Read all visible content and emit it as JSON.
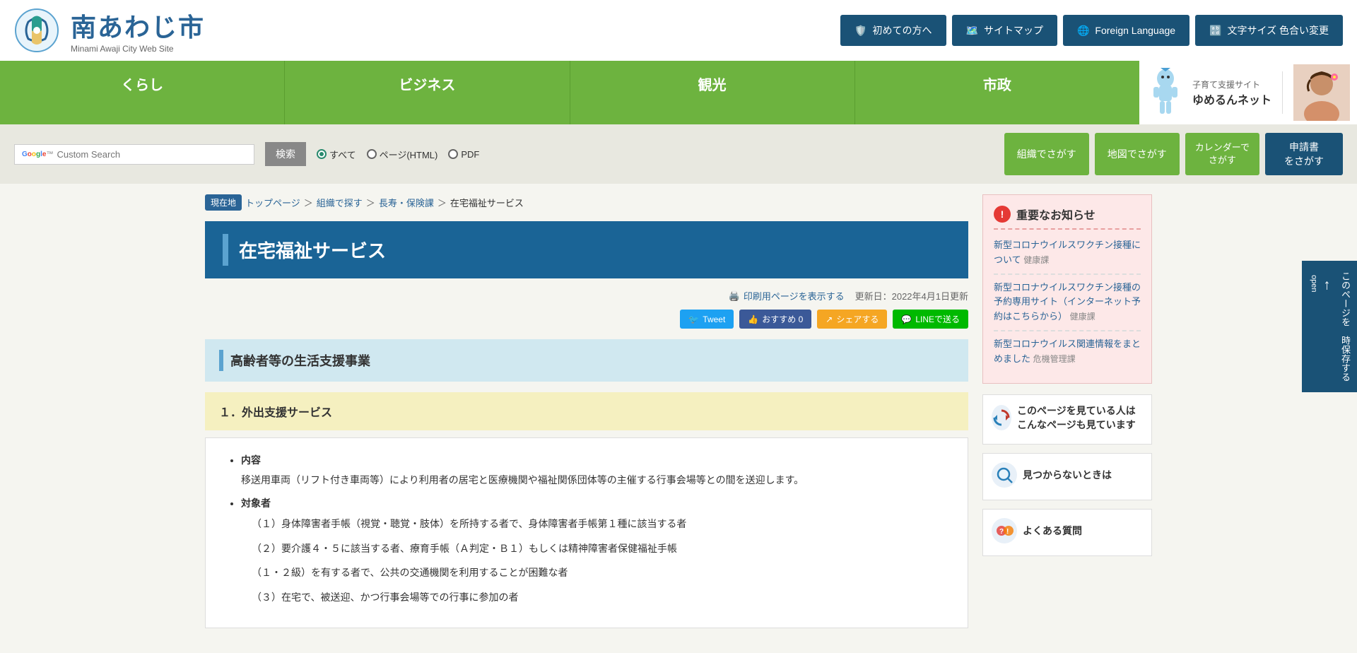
{
  "header": {
    "logo_title": "南あわじ市",
    "logo_subtitle": "Minami Awaji City Web Site",
    "buttons": [
      {
        "label": "初めての方へ",
        "icon": "🛡️"
      },
      {
        "label": "サイトマップ",
        "icon": "🗺️"
      },
      {
        "label": "Foreign Language",
        "icon": "🌐"
      },
      {
        "label": "文字サイズ 色合い変更",
        "icon": "🔡"
      }
    ]
  },
  "nav": {
    "items": [
      "くらし",
      "ビジネス",
      "観光",
      "市政"
    ],
    "banner_label": "子育て支援サイト",
    "banner_title": "ゆめるんネット"
  },
  "search": {
    "placeholder": "Custom Search",
    "google_label": "Google™",
    "button_label": "検索",
    "radio_options": [
      "すべて",
      "ページ(HTML)",
      "PDF"
    ],
    "radio_checked": 0,
    "right_buttons": [
      {
        "label": "組織でさがす"
      },
      {
        "label": "地図でさがす"
      },
      {
        "label": "カレンダーで\nさがす"
      },
      {
        "label": "申請書\nをさがす"
      }
    ]
  },
  "breadcrumb": {
    "current_label": "現在地",
    "items": [
      "トップページ",
      "組織で探す",
      "長寿・保険課",
      "在宅福祉サービス"
    ]
  },
  "page": {
    "title": "在宅福祉サービス",
    "print_label": "印刷用ページを表示する",
    "update_label": "更新日：2022年4月1日更新",
    "social": {
      "tweet": "Tweet",
      "facebook": "おすすめ 0",
      "share": "シェアする",
      "line": "LINEで送る"
    },
    "section1_title": "高齢者等の生活支援事業",
    "subsection1_title": "１．外出支援サービス",
    "content": {
      "item1_label": "内容",
      "item1_text": "移送用車両（リフト付き車両等）により利用者の居宅と医療機関や福祉関係団体等の主催する行事会場等との間を送迎します。",
      "item2_label": "対象者",
      "item2_lines": [
        "（１）身体障害者手帳（視覚・聴覚・肢体）を所持する者で、身体障害者手帳第１種に該当する者",
        "（２）要介護４・５に該当する者、療育手帳（Ａ判定・Ｂ１）もしくは精神障害者保健福祉手帳",
        "（１・２級）を有する者で、公共の交通機関を利用することが困難な者",
        "（３）在宅で、被送迎、かつ行事会場等での行事に参加の者"
      ]
    }
  },
  "sidebar": {
    "important_title": "重要なお知らせ",
    "links": [
      {
        "text": "新型コロナウイルスワクチン接種について",
        "dept": "健康課"
      },
      {
        "text": "新型コロナウイルスワクチン接種の予約専用サイト（インターネット予約はこちらから）",
        "dept": "健康課"
      },
      {
        "text": "新型コロナウイルス関連情報をまとめました",
        "dept": "危機管理課"
      }
    ],
    "section2_title": "このページを見ている人はこんなページも見ています",
    "section3_title": "見つからないときは",
    "section4_title": "よくある質問"
  },
  "right_tab": {
    "label": "このページを 時保存する",
    "open_label": "open"
  }
}
